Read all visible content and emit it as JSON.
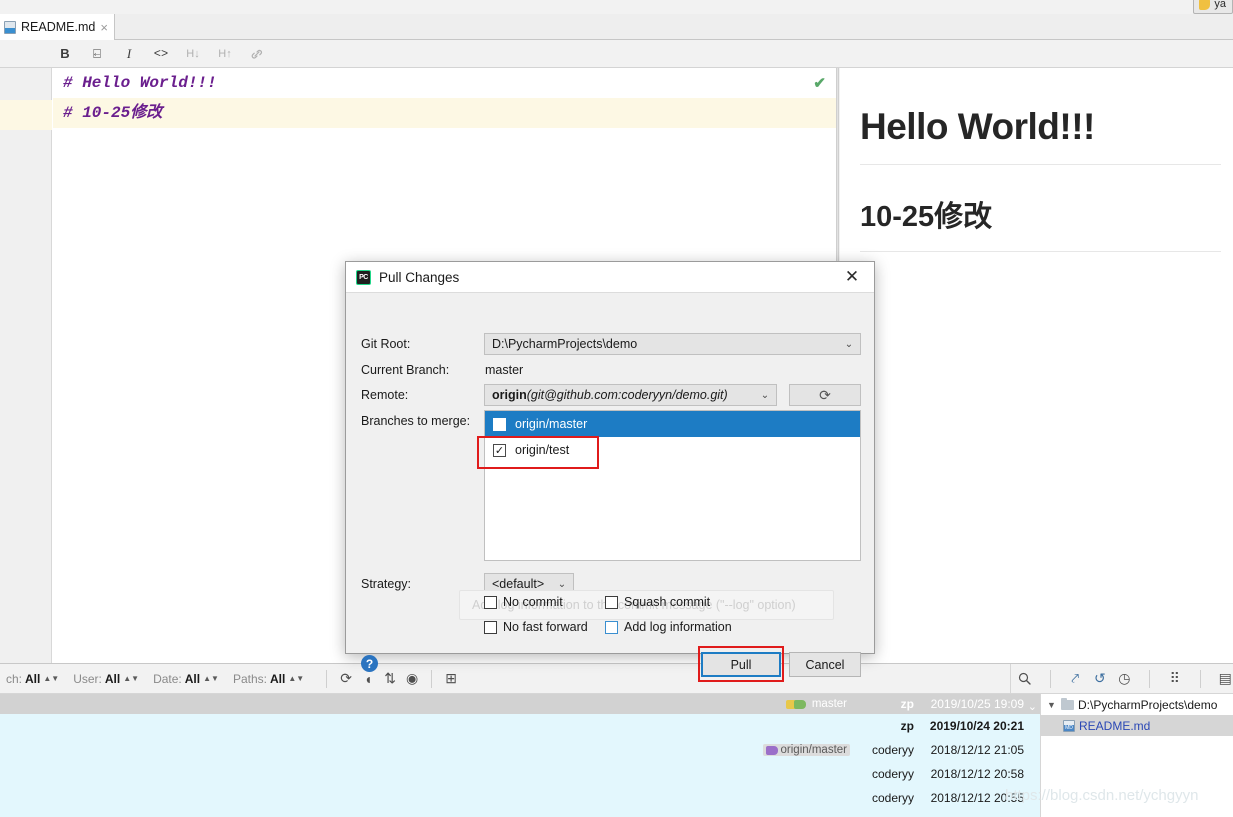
{
  "top": {
    "partial_button_label": "ya",
    "partial_button_icon": "yaml-file-icon"
  },
  "editor": {
    "tab": {
      "label": "README.md",
      "close": "×",
      "icon": "markdown-file-icon"
    },
    "toolbar": [
      {
        "name": "bold",
        "glyph": "B"
      },
      {
        "name": "strikethrough",
        "glyph": "⍇"
      },
      {
        "name": "italic",
        "glyph": "I"
      },
      {
        "name": "code",
        "glyph": "<>"
      },
      {
        "name": "header-down",
        "glyph": "H↓"
      },
      {
        "name": "header-up",
        "glyph": "H↑"
      },
      {
        "name": "link",
        "glyph": "🔗"
      }
    ],
    "lines": [
      "# Hello World!!!",
      "# 10-25修改"
    ],
    "inspection_ok": "✔"
  },
  "preview": {
    "h1": "Hello World!!!",
    "h2": "10-25修改"
  },
  "dialog": {
    "title": "Pull Changes",
    "close": "✕",
    "labels": {
      "git_root": "Git Root:",
      "current_branch": "Current Branch:",
      "remote": "Remote:",
      "branches_to_merge": "Branches to merge:",
      "strategy": "Strategy:"
    },
    "git_root_value": "D:\\PycharmProjects\\demo",
    "current_branch_value": "master",
    "remote": {
      "name": "origin",
      "url": "(git@github.com:coderyyn/demo.git)"
    },
    "refresh_icon": "refresh-icon",
    "branches": [
      {
        "label": "origin/master",
        "checked": false,
        "selected": true
      },
      {
        "label": "origin/test",
        "checked": true,
        "selected": false
      }
    ],
    "strategy_value": "<default>",
    "tooltip": "Add log information to the commit message (\"--log\" option)",
    "options": [
      {
        "label": "No commit",
        "checked": false
      },
      {
        "label": "Squash commit",
        "checked": false
      },
      {
        "label": "No fast forward",
        "checked": false
      },
      {
        "label": "Add log information",
        "checked": false
      }
    ],
    "help": "?",
    "buttons": {
      "pull": "Pull",
      "cancel": "Cancel"
    },
    "accent_blue": "#1d7cc4",
    "annotation_red": "#e01b1b"
  },
  "vcs_log": {
    "filters": [
      {
        "label": "ch:",
        "value": "All"
      },
      {
        "label": "User:",
        "value": "All"
      },
      {
        "label": "Date:",
        "value": "All"
      },
      {
        "label": "Paths:",
        "value": "All"
      }
    ],
    "toolbar_icons": [
      "refresh-icon",
      "collapse-icon",
      "sort-icon",
      "eye-icon",
      "intellisort-icon"
    ],
    "right_icons": [
      "search-icon",
      "jump-to-source-icon",
      "revert-icon",
      "history-icon",
      "group-icon",
      "show-diff-icon"
    ],
    "commits": [
      {
        "refs": [
          {
            "label": "master",
            "type": "local-branch"
          }
        ],
        "author": "zp",
        "date": "2019/10/25 19:09",
        "selected": false,
        "head": true
      },
      {
        "refs": [],
        "author": "zp",
        "date": "2019/10/24 20:21",
        "selected": true,
        "bold": true
      },
      {
        "refs": [
          {
            "label": "origin/master",
            "type": "remote-branch"
          }
        ],
        "author": "coderyy",
        "date": "2018/12/12 21:05",
        "selected": true
      },
      {
        "refs": [],
        "author": "coderyy",
        "date": "2018/12/12 20:58",
        "selected": true
      },
      {
        "refs": [],
        "author": "coderyy",
        "date": "2018/12/12 20:55",
        "selected": true
      }
    ],
    "file_tree": {
      "root": "D:\\PycharmProjects\\demo",
      "children": [
        {
          "label": "README.md",
          "icon": "markdown-file-icon",
          "selected": true
        }
      ]
    }
  },
  "watermark": "https://blog.csdn.net/ychgyyn"
}
